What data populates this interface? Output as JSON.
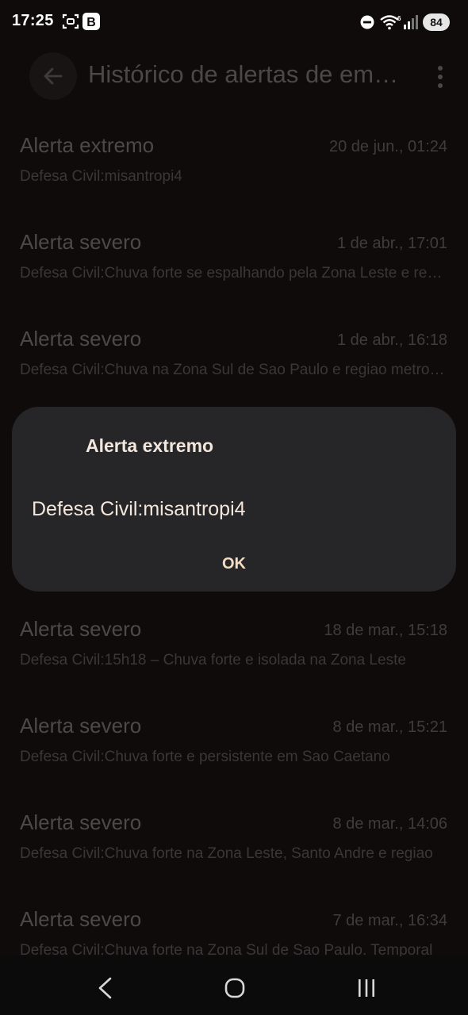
{
  "status_bar": {
    "time": "17:25",
    "battery": "84",
    "icons": [
      "screenshot-icon",
      "b-app-icon",
      "do-not-disturb-icon",
      "wifi-icon",
      "signal-icon",
      "battery-icon"
    ]
  },
  "app_bar": {
    "title": "Histórico de alertas de emergência",
    "back_icon": "arrow-left-icon",
    "more_icon": "more-vertical-icon"
  },
  "alerts": [
    {
      "title": "Alerta extremo",
      "date": "20 de jun., 01:24",
      "body": "Defesa Civil:misantropi4"
    },
    {
      "title": "Alerta severo",
      "date": "1 de abr., 17:01",
      "body": "Defesa Civil:Chuva forte se espalhando pela Zona Leste e regiao"
    },
    {
      "title": "Alerta severo",
      "date": "1 de abr., 16:18",
      "body": "Defesa Civil:Chuva na Zona Sul de Sao Paulo e regiao metropolitana"
    },
    {
      "title": "Alerta severo",
      "date": "18 de mar., 15:18",
      "body": "Defesa Civil:15h18 – Chuva forte e isolada na Zona Leste"
    },
    {
      "title": "Alerta severo",
      "date": "8 de mar., 15:21",
      "body": "Defesa Civil:Chuva forte e persistente em Sao Caetano"
    },
    {
      "title": "Alerta severo",
      "date": "8 de mar., 14:06",
      "body": "Defesa Civil:Chuva forte na Zona Leste, Santo Andre e regiao"
    },
    {
      "title": "Alerta severo",
      "date": "7 de mar., 16:34",
      "body": "Defesa Civil:Chuva forte na Zona Sul de Sao Paulo. Temporal"
    }
  ],
  "dialog": {
    "title": "Alerta extremo",
    "message": "Defesa Civil:misantropi4",
    "ok_label": "OK"
  },
  "nav_bar": {
    "icons": [
      "back-icon",
      "home-icon",
      "recents-icon"
    ]
  },
  "colors": {
    "background": "#0e0b0a",
    "dialog": "#262527",
    "dialog_text": "#f3e7dd",
    "ok_text": "#f3dcc3"
  }
}
